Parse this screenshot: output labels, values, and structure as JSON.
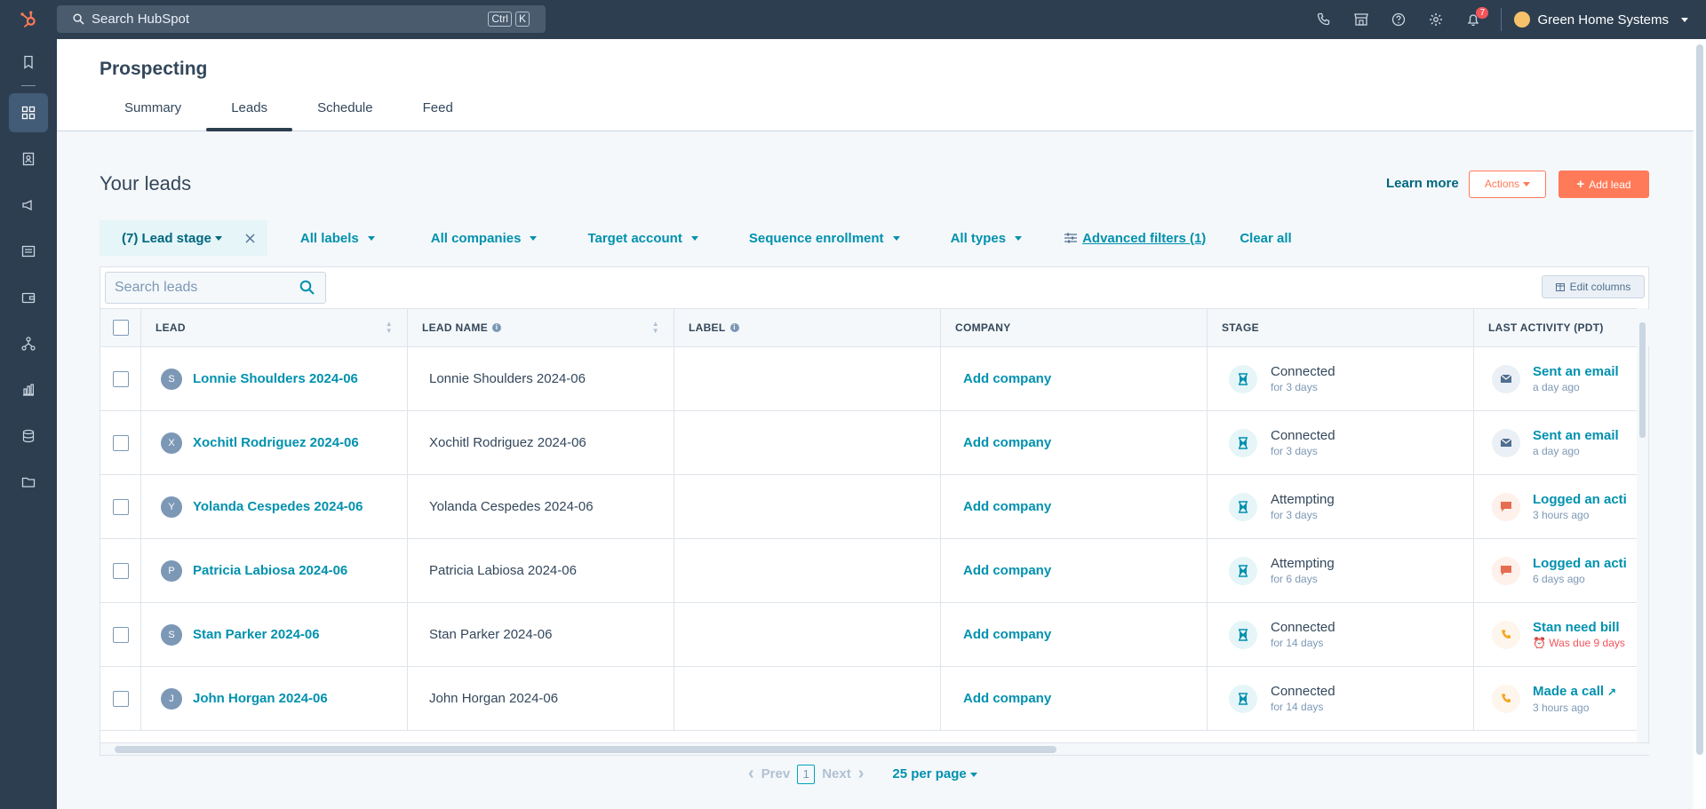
{
  "topbar": {
    "search_placeholder": "Search HubSpot",
    "kbd_ctrl": "Ctrl",
    "kbd_k": "K",
    "notifications_count": "7",
    "account_name": "Green Home Systems"
  },
  "page": {
    "title": "Prospecting",
    "tabs": [
      {
        "label": "Summary"
      },
      {
        "label": "Leads"
      },
      {
        "label": "Schedule"
      },
      {
        "label": "Feed"
      }
    ]
  },
  "leads": {
    "title": "Your leads",
    "learn_more": "Learn more",
    "actions_label": "Actions",
    "add_lead_label": "Add lead"
  },
  "filters": {
    "lead_stage": "(7) Lead stage",
    "labels": "All labels",
    "companies": "All companies",
    "target_account": "Target account",
    "sequence": "Sequence enrollment",
    "types": "All types",
    "advanced": "Advanced filters (1)",
    "clear_all": "Clear all"
  },
  "table": {
    "search_placeholder": "Search leads",
    "edit_columns": "Edit columns",
    "headers": {
      "lead": "LEAD",
      "lead_name": "LEAD NAME",
      "label": "LABEL",
      "company": "COMPANY",
      "stage": "STAGE",
      "last_activity": "LAST ACTIVITY (PDT)"
    },
    "rows": [
      {
        "initial": "S",
        "lead": "Lonnie Shoulders 2024-06",
        "name": "Lonnie Shoulders 2024-06",
        "company": "Add company",
        "stage": "Connected",
        "stage_sub": "for 3 days",
        "activity": "Sent an email",
        "activity_sub": "a day ago"
      },
      {
        "initial": "X",
        "lead": "Xochitl Rodriguez 2024-06",
        "name": "Xochitl Rodriguez 2024-06",
        "company": "Add company",
        "stage": "Connected",
        "stage_sub": "for 3 days",
        "activity": "Sent an email",
        "activity_sub": "a day ago"
      },
      {
        "initial": "Y",
        "lead": "Yolanda Cespedes 2024-06",
        "name": "Yolanda Cespedes 2024-06",
        "company": "Add company",
        "stage": "Attempting",
        "stage_sub": "for 3 days",
        "activity": "Logged an acti",
        "activity_sub": "3 hours ago"
      },
      {
        "initial": "P",
        "lead": "Patricia Labiosa 2024-06",
        "name": "Patricia Labiosa 2024-06",
        "company": "Add company",
        "stage": "Attempting",
        "stage_sub": "for 6 days",
        "activity": "Logged an acti",
        "activity_sub": "6 days ago"
      },
      {
        "initial": "S",
        "lead": "Stan Parker 2024-06",
        "name": "Stan Parker 2024-06",
        "company": "Add company",
        "stage": "Connected",
        "stage_sub": "for 14 days",
        "activity": "Stan need bill",
        "activity_sub": "Was due 9 days"
      },
      {
        "initial": "J",
        "lead": "John Horgan 2024-06",
        "name": "John Horgan 2024-06",
        "company": "Add company",
        "stage": "Connected",
        "stage_sub": "for 14 days",
        "activity": "Made a call",
        "activity_sub": "3 hours ago"
      }
    ]
  },
  "pager": {
    "prev": "Prev",
    "page": "1",
    "next": "Next",
    "per_page": "25 per page"
  },
  "colors": {
    "nav": "#2d3e50",
    "accent": "#ff7a59",
    "link": "#0091ae"
  }
}
